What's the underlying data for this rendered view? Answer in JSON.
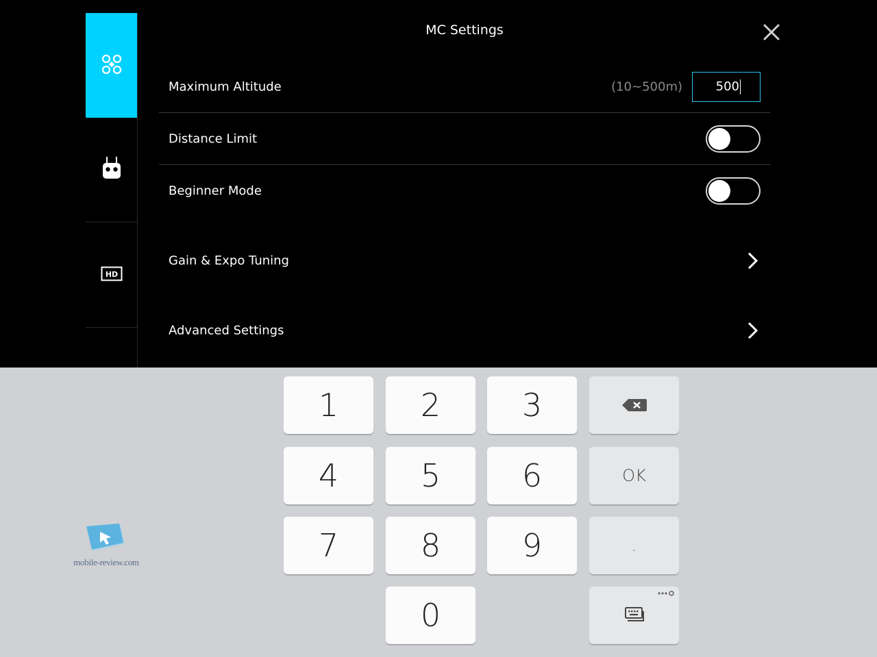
{
  "header": {
    "title": "MC Settings"
  },
  "sidebar": {
    "tabs": [
      {
        "icon": "aircraft-icon",
        "active": true
      },
      {
        "icon": "remote-controller-icon",
        "active": false
      },
      {
        "icon": "hd-video-icon",
        "active": false
      }
    ]
  },
  "settings": {
    "max_altitude": {
      "label": "Maximum Altitude",
      "range": "(10~500m)",
      "value": "500"
    },
    "distance_limit": {
      "label": "Distance Limit",
      "enabled": false
    },
    "beginner_mode": {
      "label": "Beginner Mode",
      "enabled": false
    },
    "gain_expo": {
      "label": "Gain & Expo Tuning"
    },
    "advanced": {
      "label": "Advanced Settings"
    }
  },
  "keyboard": {
    "keys": [
      "1",
      "2",
      "3",
      "4",
      "5",
      "6",
      "7",
      "8",
      "9",
      "0"
    ],
    "ok_label": "OK",
    "dot_label": "."
  },
  "watermark": {
    "text": "mobile-review.com"
  },
  "colors": {
    "accent": "#00d2ff",
    "input_border": "#2fc7ef",
    "keyboard_bg": "#cfd1d4"
  }
}
